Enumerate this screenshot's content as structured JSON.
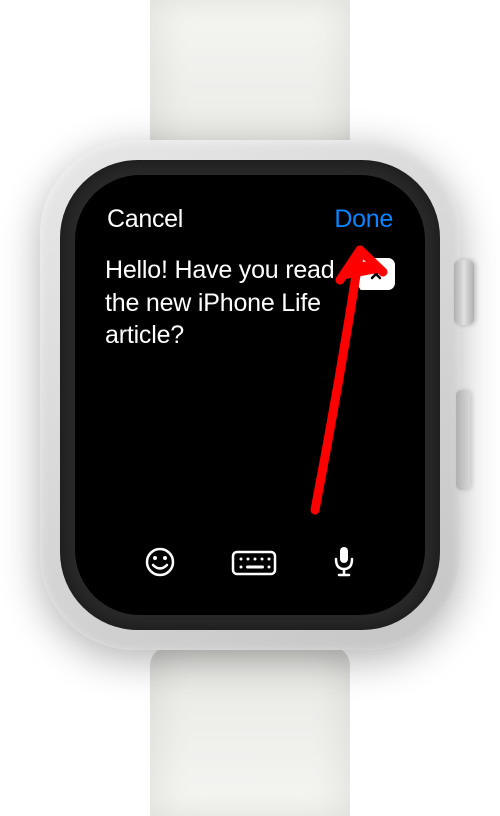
{
  "header": {
    "cancel_label": "Cancel",
    "done_label": "Done"
  },
  "message": {
    "text": "Hello! Have you read the new iPhone Life article?"
  },
  "icons": {
    "emoji": "emoji-icon",
    "keyboard": "keyboard-icon",
    "mic": "mic-icon",
    "delete": "delete-icon"
  },
  "colors": {
    "accent": "#0a84ff",
    "annotation": "#ff0000"
  }
}
